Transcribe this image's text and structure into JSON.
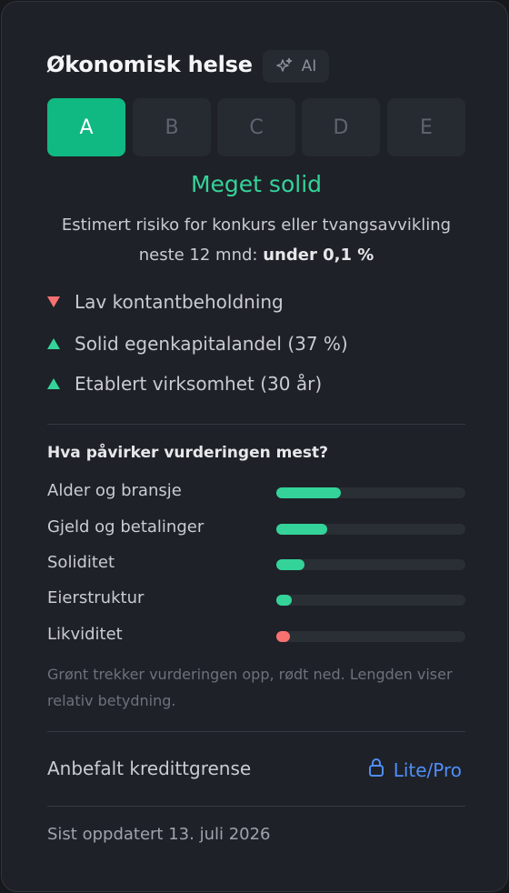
{
  "header": {
    "title": "Økonomisk helse",
    "ai_badge": "AI"
  },
  "grades": {
    "items": [
      "A",
      "B",
      "C",
      "D",
      "E"
    ],
    "selected": "A"
  },
  "rating": {
    "label": "Meget solid",
    "risk_text": "Estimert risiko for konkurs eller tvangsavvikling neste 12 mnd: ",
    "risk_value": "under 0,1 %"
  },
  "factors": [
    {
      "label": "Lav kontantbeholdning",
      "direction": "down"
    },
    {
      "label": "Solid egenkapitalandel (37 %)",
      "direction": "up"
    },
    {
      "label": "Etablert virksomhet (30 år)",
      "direction": "up"
    }
  ],
  "influence": {
    "heading": "Hva påvirker vurderingen mest?",
    "items": [
      {
        "label": "Alder og bransje",
        "weight": 0.34,
        "direction": "positive"
      },
      {
        "label": "Gjeld og betalinger",
        "weight": 0.27,
        "direction": "positive"
      },
      {
        "label": "Soliditet",
        "weight": 0.15,
        "direction": "positive"
      },
      {
        "label": "Eierstruktur",
        "weight": 0.08,
        "direction": "positive"
      },
      {
        "label": "Likviditet",
        "weight": 0.07,
        "direction": "negative"
      }
    ],
    "hint": "Grønt trekker vurderingen opp, rødt ned. Lengden viser relativ betydning."
  },
  "credit": {
    "label": "Anbefalt kredittgrense",
    "link_label": "Lite/Pro",
    "link_icon": "lock-icon"
  },
  "footer": {
    "updated": "Sist oppdatert 13. juli 2026"
  },
  "colors": {
    "accent_green": "#10b981",
    "text_green": "#34d399",
    "negative_red": "#f87171",
    "link_blue": "#4f8ef7"
  }
}
